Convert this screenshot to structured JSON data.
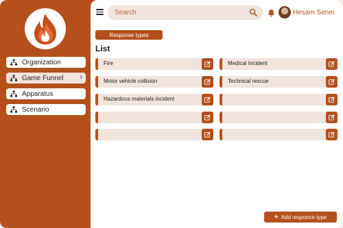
{
  "sidebar": {
    "items": [
      {
        "label": "Organization",
        "icon": "hierarchy-icon",
        "active": false
      },
      {
        "label": "Game Funnel",
        "icon": "hierarchy-icon",
        "active": true,
        "chevron": "›"
      },
      {
        "label": "Apparatus",
        "icon": "hierarchy-icon",
        "active": false
      },
      {
        "label": "Scenario",
        "icon": "hierarchy-icon",
        "active": false
      }
    ]
  },
  "topbar": {
    "search_placeholder": "Search",
    "user_name": "Hesam Senei"
  },
  "section": {
    "chip_label": "Response types",
    "list_title": "List"
  },
  "list": {
    "left": [
      "Fire",
      "Motor vehicle collision",
      "Hazardous materials incident",
      "",
      ""
    ],
    "right": [
      "Medical Incident",
      "Technical rescue",
      "",
      "",
      ""
    ]
  },
  "actions": {
    "add_label": "Add responce type",
    "add_icon": "+"
  },
  "colors": {
    "accent": "#b5501d",
    "row_bg": "#f1e4dd"
  }
}
